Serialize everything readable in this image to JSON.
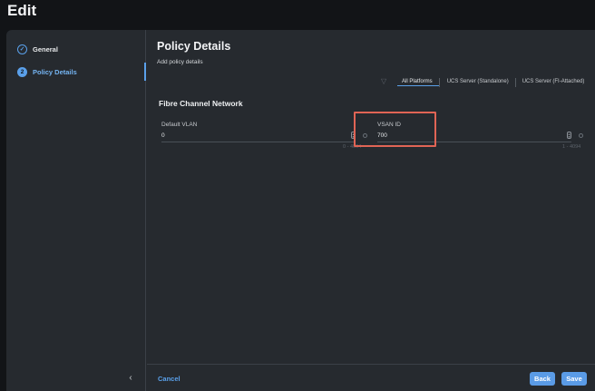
{
  "page": {
    "title": "Edit"
  },
  "sidebar": {
    "steps": [
      {
        "label": "General",
        "state": "done",
        "icon": "check-icon"
      },
      {
        "label": "Policy Details",
        "number": "2",
        "state": "active"
      }
    ],
    "collapse_icon": "‹"
  },
  "content": {
    "title": "Policy Details",
    "subtitle": "Add policy details",
    "filter_icon": "filter-icon",
    "platform_tabs": [
      {
        "label": "All Platforms",
        "active": true
      },
      {
        "label": "UCS Server (Standalone)",
        "active": false
      },
      {
        "label": "UCS Server (FI-Attached)",
        "active": false
      }
    ],
    "section_title": "Fibre Channel Network",
    "fields": {
      "default_vlan": {
        "label": "Default VLAN",
        "value": "0",
        "hint": "0 - 4094"
      },
      "vsan_id": {
        "label": "VSAN ID",
        "value": "700",
        "hint": "1 - 4094"
      }
    }
  },
  "footer": {
    "cancel": "Cancel",
    "back": "Back",
    "save": "Save"
  },
  "colors": {
    "accent": "#5aa0ea",
    "highlight_box": "#e06455",
    "panel": "#262a2f",
    "background": "#121417"
  }
}
